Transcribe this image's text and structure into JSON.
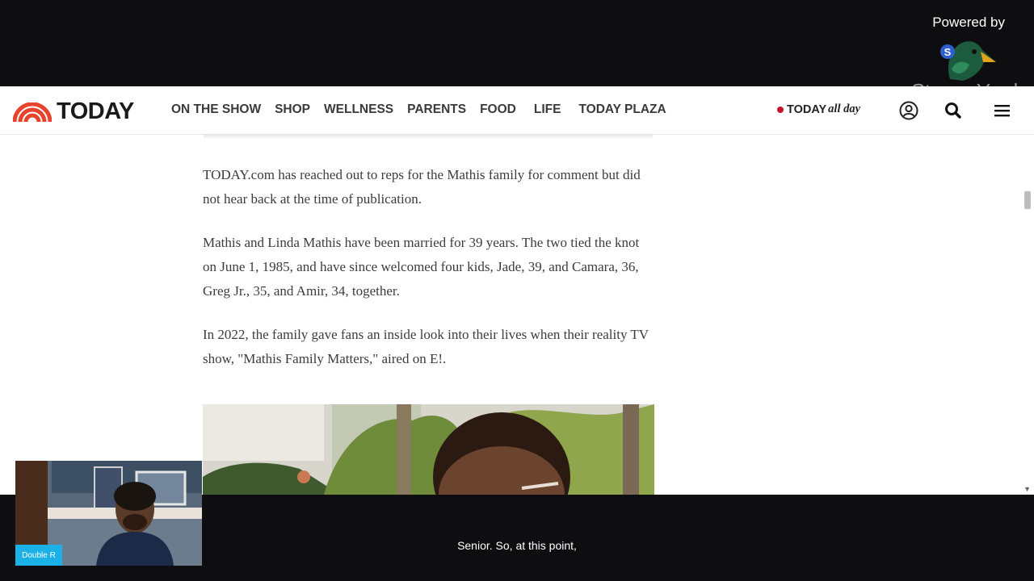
{
  "overlay": {
    "powered_by": "Powered by",
    "watermark": "StreamYard",
    "duck_badge": "S"
  },
  "site": {
    "logo_text": "TODAY",
    "nav": [
      "ON THE SHOW",
      "SHOP",
      "WELLNESS",
      "PARENTS",
      "FOOD",
      "LIFE",
      "TODAY PLAZA"
    ],
    "allday_brand": "TODAY",
    "allday_suffix": "all day",
    "icons": [
      "account-icon",
      "search-icon",
      "menu-icon"
    ]
  },
  "article": {
    "paragraphs": [
      "TODAY.com has reached out to reps for the Mathis family for comment but did not hear back at the time of publication.",
      "Mathis and Linda Mathis have been married for 39 years. The two tied the knot on June 1, 1985, and have since welcomed four kids, Jade, 39, and Camara, 36, Greg Jr., 35, and Amir, 34, together.",
      "In 2022, the family gave fans an inside look into their lives when their reality TV show, \"Mathis Family Matters,\" aired on E!."
    ]
  },
  "webcam": {
    "name_badge": "Double R"
  },
  "caption": {
    "text": "Senior. So, at this point,"
  },
  "colors": {
    "brand_red": "#c8102e",
    "badge_blue": "#1ab0e8",
    "background": "#0e0e10"
  }
}
